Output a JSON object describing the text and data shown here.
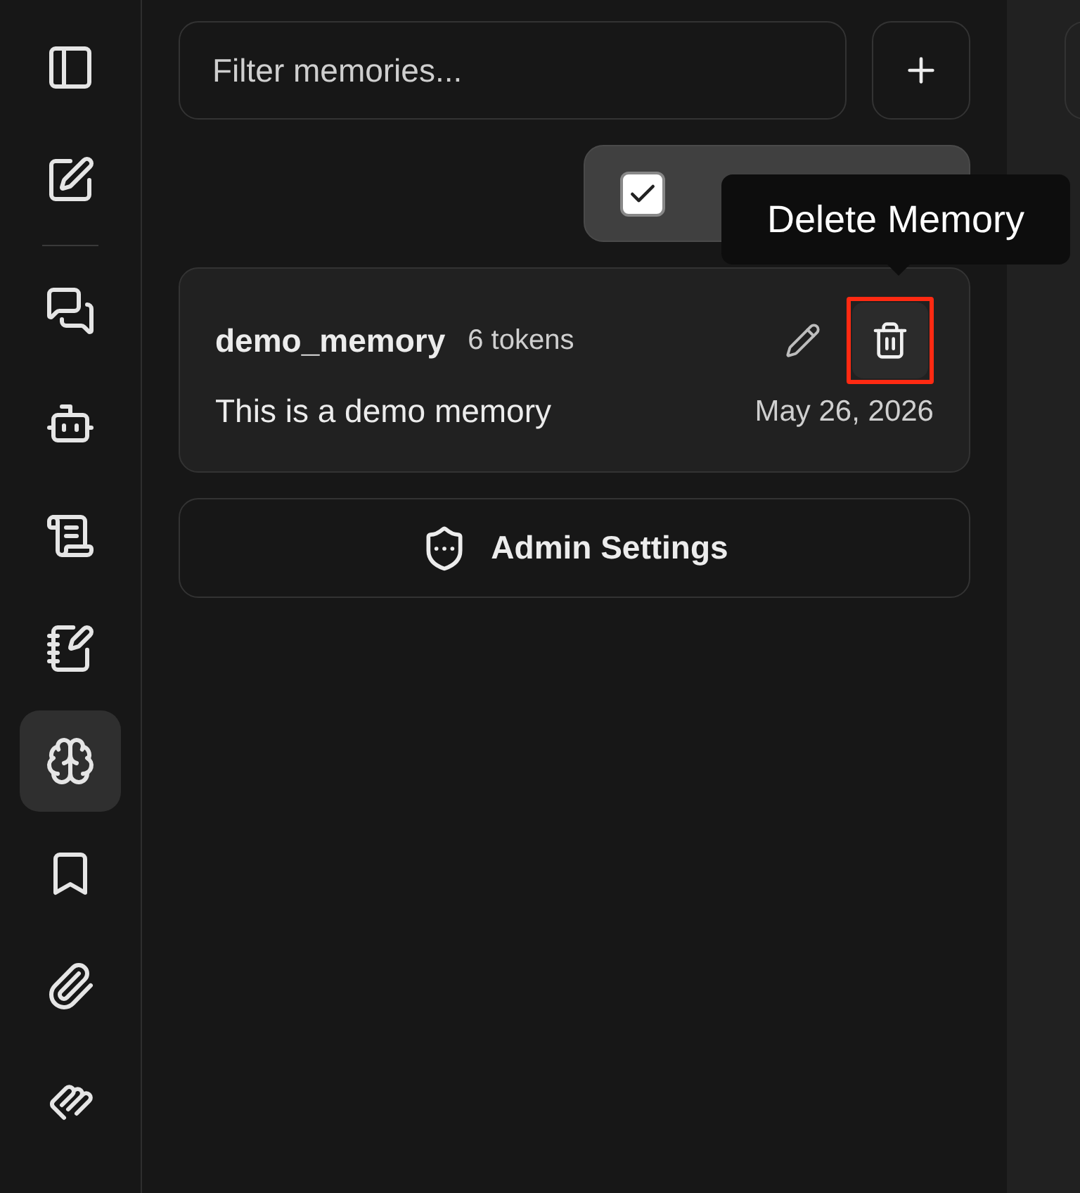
{
  "rail": {
    "items": [
      {
        "kind": "panel",
        "selected": false
      },
      {
        "kind": "new",
        "selected": false
      },
      {
        "kind": "divider"
      },
      {
        "kind": "chats",
        "selected": false
      },
      {
        "kind": "bot",
        "selected": false
      },
      {
        "kind": "scroll",
        "selected": false
      },
      {
        "kind": "notebook",
        "selected": false
      },
      {
        "kind": "brain",
        "selected": true
      },
      {
        "kind": "bookmark",
        "selected": false
      },
      {
        "kind": "clip",
        "selected": false
      },
      {
        "kind": "squiggle",
        "selected": false
      }
    ]
  },
  "filter": {
    "placeholder": "Filter memories..."
  },
  "use_toggle": {
    "checked": true
  },
  "tooltip": {
    "text": "Delete Memory"
  },
  "memories": [
    {
      "name": "demo_memory",
      "tokens": "6 tokens",
      "text": "This is a demo memory",
      "date": "May 26, 2026",
      "delete_highlighted": true
    }
  ],
  "admin_button": {
    "label": "Admin Settings"
  }
}
